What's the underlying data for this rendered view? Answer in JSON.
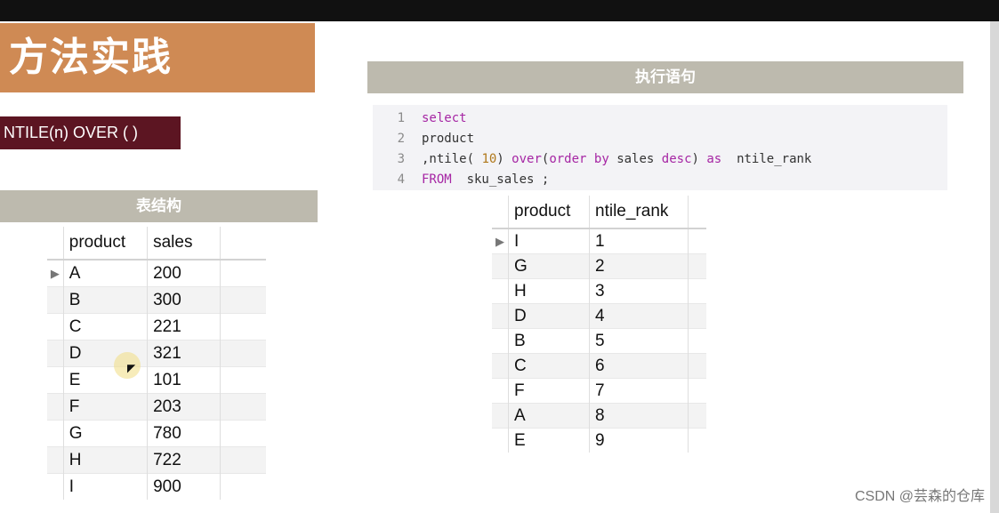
{
  "slide": {
    "title": "方法实践",
    "function_label": "NTILE(n) OVER (   )",
    "table_section_header": "表结构",
    "exec_section_header": "执行语句"
  },
  "code": {
    "lines": [
      {
        "num": "1",
        "tokens": [
          {
            "text": "select",
            "kind": "kw"
          }
        ]
      },
      {
        "num": "2",
        "tokens": [
          {
            "text": "product",
            "kind": "tx"
          }
        ]
      },
      {
        "num": "3",
        "tokens": [
          {
            "text": ",ntile( ",
            "kind": "tx"
          },
          {
            "text": "10",
            "kind": "num"
          },
          {
            "text": ") ",
            "kind": "tx"
          },
          {
            "text": "over",
            "kind": "kw"
          },
          {
            "text": "(",
            "kind": "tx"
          },
          {
            "text": "order",
            "kind": "kw"
          },
          {
            "text": " ",
            "kind": "tx"
          },
          {
            "text": "by",
            "kind": "kw"
          },
          {
            "text": " sales ",
            "kind": "tx"
          },
          {
            "text": "desc",
            "kind": "kw"
          },
          {
            "text": ") ",
            "kind": "tx"
          },
          {
            "text": "as",
            "kind": "kw"
          },
          {
            "text": "  ntile_rank",
            "kind": "tx"
          }
        ]
      },
      {
        "num": "4",
        "tokens": [
          {
            "text": "FROM",
            "kind": "kw"
          },
          {
            "text": "  sku_sales ;",
            "kind": "tx"
          }
        ]
      }
    ]
  },
  "source_table": {
    "columns": [
      "product",
      "sales"
    ],
    "rows": [
      [
        "A",
        "200"
      ],
      [
        "B",
        "300"
      ],
      [
        "C",
        "221"
      ],
      [
        "D",
        "321"
      ],
      [
        "E",
        "101"
      ],
      [
        "F",
        "203"
      ],
      [
        "G",
        "780"
      ],
      [
        "H",
        "722"
      ],
      [
        "I",
        "900"
      ]
    ],
    "current_row_marker": "▶"
  },
  "result_table": {
    "columns": [
      "product",
      "ntile_rank"
    ],
    "rows": [
      [
        "I",
        "1"
      ],
      [
        "G",
        "2"
      ],
      [
        "H",
        "3"
      ],
      [
        "D",
        "4"
      ],
      [
        "B",
        "5"
      ],
      [
        "C",
        "6"
      ],
      [
        "F",
        "7"
      ],
      [
        "A",
        "8"
      ],
      [
        "E",
        "9"
      ]
    ],
    "current_row_marker": "▶"
  },
  "watermark": "CSDN @芸森的仓库",
  "colors": {
    "title_bg": "#cf8a54",
    "function_bg": "#5c1522",
    "section_header_bg": "#bdbaae",
    "code_keyword": "#a626a4",
    "code_number": "#b0781a"
  }
}
